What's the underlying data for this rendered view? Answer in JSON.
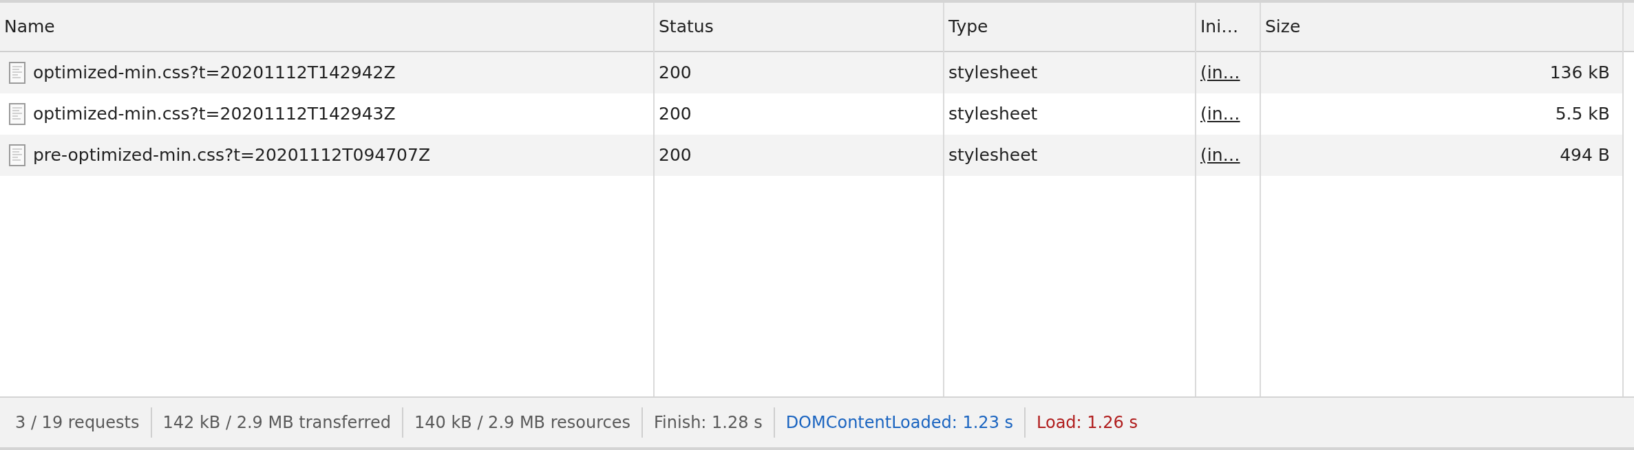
{
  "table": {
    "columns": [
      "Name",
      "Status",
      "Type",
      "Ini…",
      "Size"
    ],
    "rows": [
      {
        "name": "optimized-min.css?t=20201112T142942Z",
        "status": "200",
        "type": "stylesheet",
        "initiator": "(in…",
        "size": "136 kB"
      },
      {
        "name": "optimized-min.css?t=20201112T142943Z",
        "status": "200",
        "type": "stylesheet",
        "initiator": "(in…",
        "size": "5.5 kB"
      },
      {
        "name": "pre-optimized-min.css?t=20201112T094707Z",
        "status": "200",
        "type": "stylesheet",
        "initiator": "(in…",
        "size": "494 B"
      }
    ]
  },
  "status_bar": [
    {
      "text": "3 / 19 requests",
      "color": "#595959"
    },
    {
      "text": "142 kB / 2.9 MB transferred",
      "color": "#595959"
    },
    {
      "text": "140 kB / 2.9 MB resources",
      "color": "#595959"
    },
    {
      "text": "Finish: 1.28 s",
      "color": "#595959"
    },
    {
      "text": "DOMContentLoaded: 1.23 s",
      "color": "#1a64c0"
    },
    {
      "text": "Load: 1.26 s",
      "color": "#b01c1c"
    }
  ]
}
